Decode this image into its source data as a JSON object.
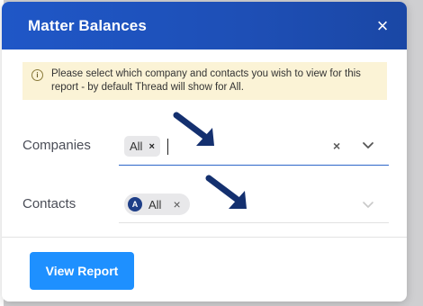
{
  "modal": {
    "title": "Matter Balances",
    "close_label": "×"
  },
  "notice": {
    "icon": "info-icon",
    "text": "Please select which company and contacts you wish to view for this report - by default Thread will show for All."
  },
  "companies": {
    "label": "Companies",
    "selected_chip": "All",
    "chip_remove": "×",
    "clear_label": "×"
  },
  "contacts": {
    "label": "Contacts",
    "selected_chip": "All",
    "chip_avatar": "A",
    "chip_remove": "×"
  },
  "footer": {
    "view_report_label": "View Report"
  },
  "colors": {
    "header_blue": "#1f57c7",
    "button_blue": "#1e90ff",
    "notice_bg": "#fbf3d6",
    "arrow_navy": "#14306f"
  }
}
